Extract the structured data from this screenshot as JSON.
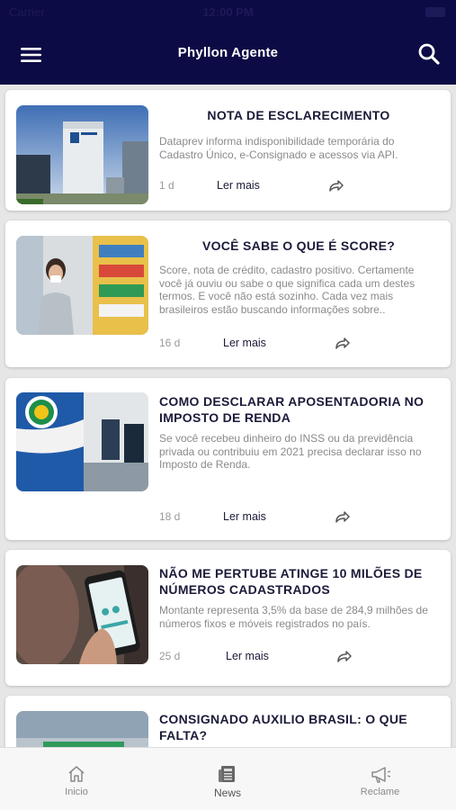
{
  "app": {
    "title": "Phyllon Agente"
  },
  "status_bar": {
    "carrier": "Carrier",
    "time": "12:00 PM"
  },
  "articles": [
    {
      "title": "NOTA DE ESCLARECIMENTO",
      "summary": "Dataprev informa indisponibilidade temporária do Cadastro Único, e-Consignado e acessos via API.",
      "age": "1 d",
      "read_more": "Ler mais",
      "image": "dataprev-building"
    },
    {
      "title": "VOCÊ SABE O QUE É SCORE?",
      "summary": "Score, nota de crédito, cadastro positivo. Certamente você já ouviu ou sabe o que significa cada um destes termos. E você não está sozinho. Cada vez mais brasileiros estão buscando informações sobre..",
      "age": "16 d",
      "read_more": "Ler mais",
      "image": "woman-supermarket"
    },
    {
      "title": "COMO DESCLARAR APOSENTADORIA NO IMPOSTO DE RENDA",
      "summary": "Se você recebeu dinheiro do INSS ou da previdência privada ou contribuiu em 2021 precisa declarar isso no Imposto de Renda.",
      "age": "18 d",
      "read_more": "Ler mais",
      "image": "previdencia-social"
    },
    {
      "title": "NÃO ME PERTUBE ATINGE 10 MILÕES DE NÚMEROS CADASTRADOS",
      "summary": "Montante representa 3,5% da base de 284,9 milhões de números fixos e móveis registrados no país.",
      "age": "25 d",
      "read_more": "Ler mais",
      "image": "hand-smartphone"
    },
    {
      "title": "CONSIGNADO AUXILIO BRASIL: O QUE FALTA?",
      "image": "auxilio-brasil"
    }
  ],
  "tabs": [
    {
      "label": "Inicio",
      "icon": "home-icon"
    },
    {
      "label": "News",
      "icon": "newspaper-icon"
    },
    {
      "label": "Reclame",
      "icon": "megaphone-icon"
    }
  ],
  "colors": {
    "header": "#0d0b45",
    "title_text": "#1b1b3a",
    "summary_text": "#8a8a8a",
    "background": "#e6e6e6"
  }
}
